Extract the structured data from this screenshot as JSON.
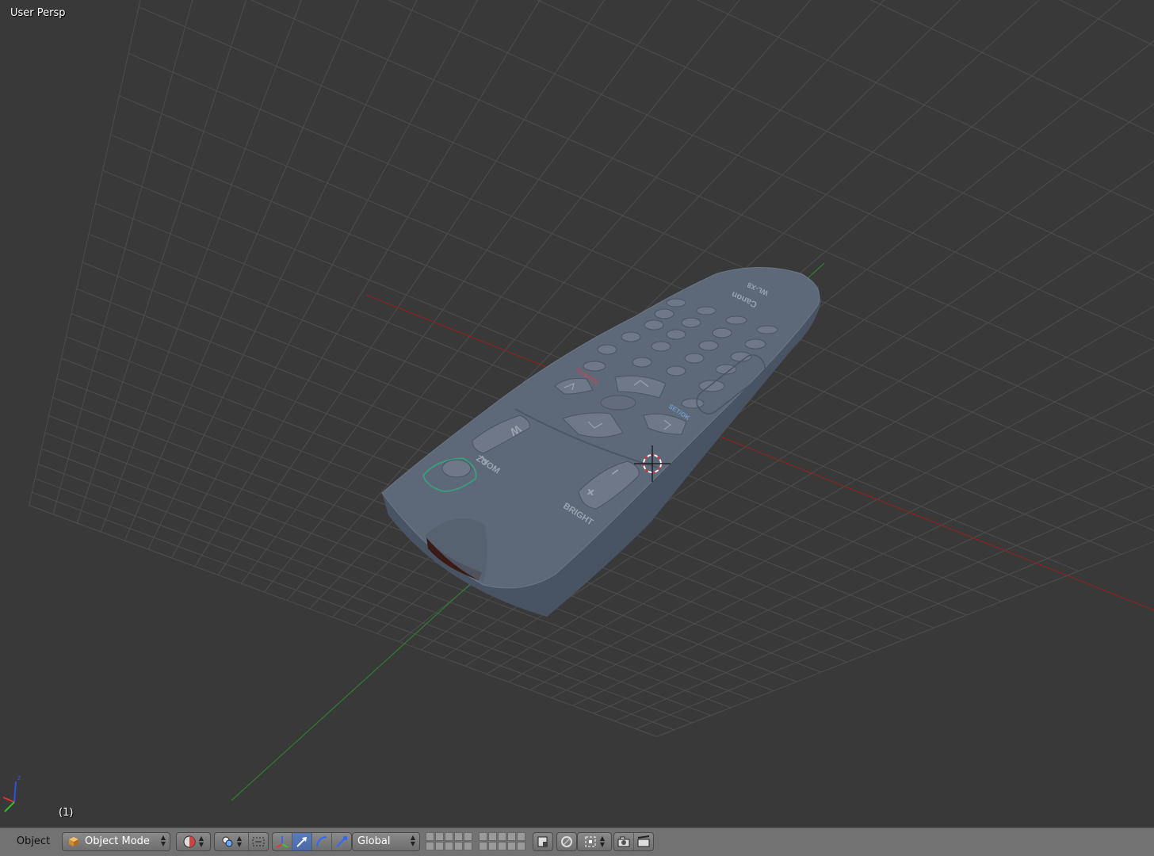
{
  "viewport": {
    "view_label": "User Persp",
    "frame_label": "(1)",
    "colors": {
      "background": "#393939",
      "grid": "#4d4d4d",
      "x_axis": "#8b2323",
      "y_axis": "#2f7d2f",
      "model": "#5b6574"
    }
  },
  "model": {
    "brand": "Canon",
    "model_name": "WL-X8",
    "zoom_label": "ZOOM",
    "zoom_w": "W",
    "zoom_t": "T",
    "bright_label": "BRIGHT",
    "bright_plus": "+",
    "bright_minus": "–",
    "cancel_label": "CANCEL",
    "setdk_label": "SET/OK"
  },
  "header": {
    "menu_object": "Object",
    "mode": "Object Mode",
    "transform_orientation": "Global",
    "icons": [
      "cube-icon",
      "viewport-shading-icon",
      "pivot-point-icon",
      "manipulator-icon",
      "translate-icon",
      "rotate-icon",
      "scale-icon",
      "layer-icon",
      "snap-icon",
      "render-icon"
    ]
  }
}
